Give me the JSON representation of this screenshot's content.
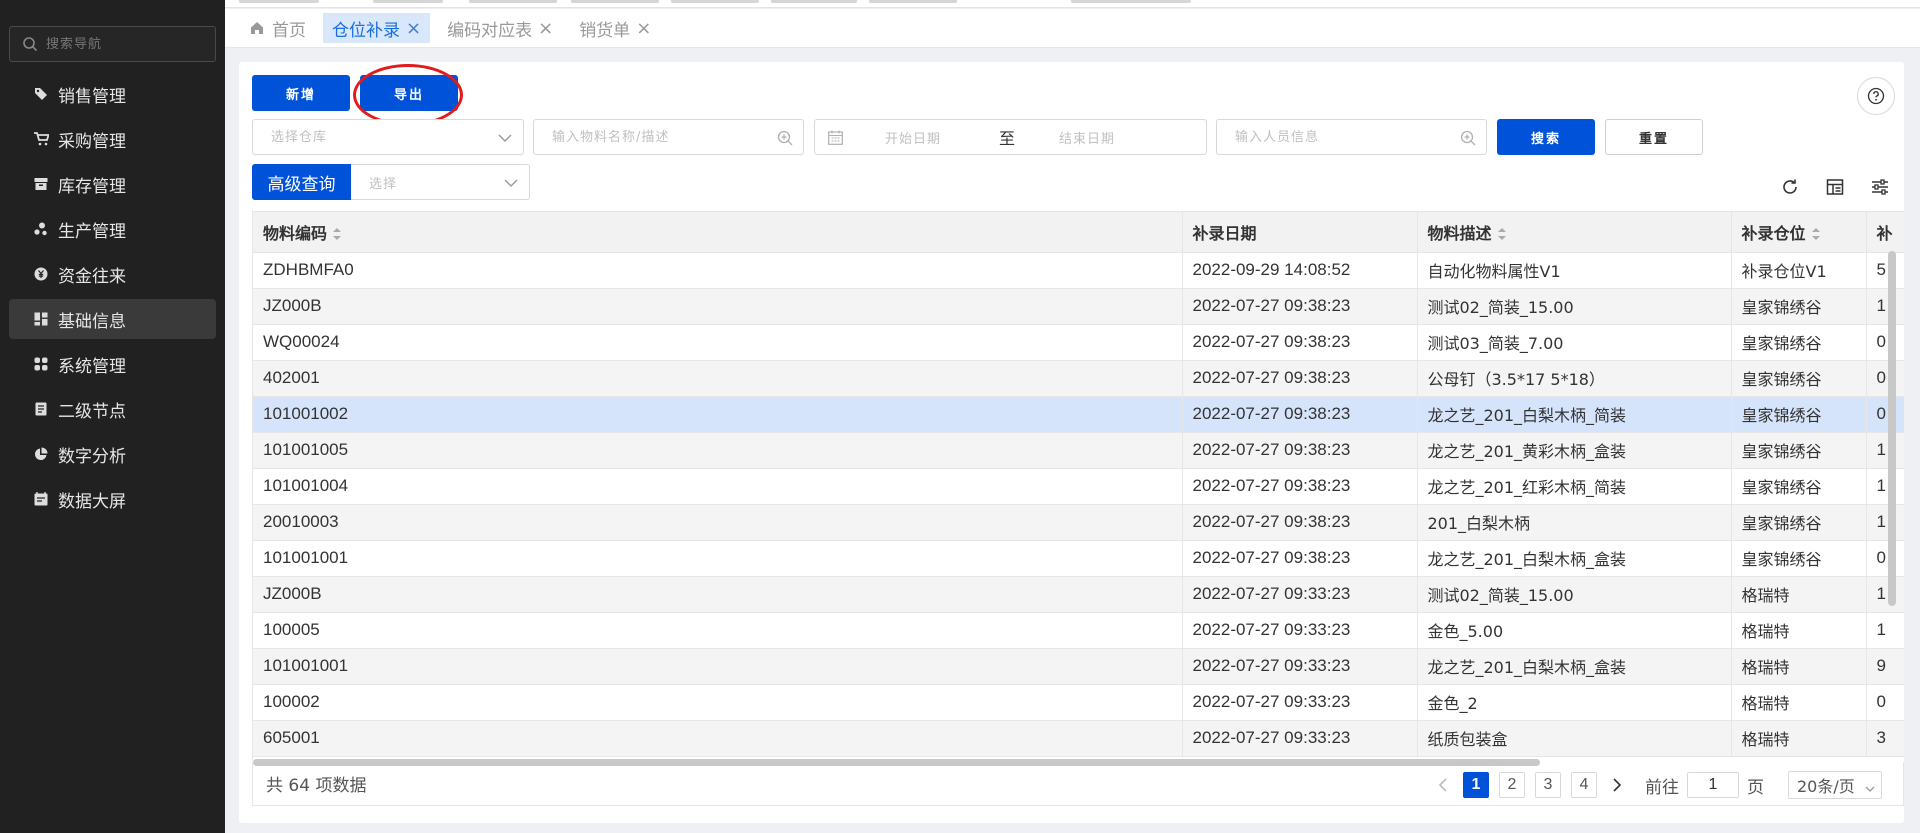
{
  "sidebar": {
    "search_placeholder": "搜索导航",
    "items": [
      {
        "label": "销售管理",
        "icon": "tag-icon"
      },
      {
        "label": "采购管理",
        "icon": "cart-icon"
      },
      {
        "label": "库存管理",
        "icon": "archive-icon"
      },
      {
        "label": "生产管理",
        "icon": "cluster-icon"
      },
      {
        "label": "资金往来",
        "icon": "currency-icon"
      },
      {
        "label": "基础信息",
        "icon": "dashboard-icon",
        "active": true
      },
      {
        "label": "系统管理",
        "icon": "grid-icon"
      },
      {
        "label": "二级节点",
        "icon": "document-icon"
      },
      {
        "label": "数字分析",
        "icon": "pie-chart-icon"
      },
      {
        "label": "数据大屏",
        "icon": "screen-icon"
      }
    ]
  },
  "tabs": [
    {
      "label": "首页",
      "icon": "home-icon",
      "closable": false
    },
    {
      "label": "仓位补录",
      "active": true,
      "closable": true
    },
    {
      "label": "编码对应表",
      "closable": true
    },
    {
      "label": "销货单",
      "closable": true
    }
  ],
  "toolbar": {
    "add_label": "新增",
    "export_label": "导出",
    "warehouse_placeholder": "选择仓库",
    "material_placeholder": "输入物料名称/描述",
    "start_date_placeholder": "开始日期",
    "date_separator": "至",
    "end_date_placeholder": "结束日期",
    "person_placeholder": "输入人员信息",
    "search_label": "搜索",
    "reset_label": "重置",
    "advanced_label": "高级查询",
    "advanced_placeholder": "选择"
  },
  "table": {
    "columns": [
      "物料编码",
      "补录日期",
      "物料描述",
      "补录仓位",
      "补"
    ],
    "rows": [
      [
        "ZDHBMFA0",
        "2022-09-29 14:08:52",
        "自动化物料属性V1",
        "补录仓位V1",
        "5"
      ],
      [
        "JZ000B",
        "2022-07-27 09:38:23",
        "测试02_简装_15.00",
        "皇家锦绣谷",
        "1"
      ],
      [
        "WQ00024",
        "2022-07-27 09:38:23",
        "测试03_简装_7.00",
        "皇家锦绣谷",
        "0"
      ],
      [
        "402001",
        "2022-07-27 09:38:23",
        "公母钉（3.5*17 5*18）",
        "皇家锦绣谷",
        "0"
      ],
      [
        "101001002",
        "2022-07-27 09:38:23",
        "龙之艺_201_白梨木柄_简装",
        "皇家锦绣谷",
        "0"
      ],
      [
        "101001005",
        "2022-07-27 09:38:23",
        "龙之艺_201_黄彩木柄_盒装",
        "皇家锦绣谷",
        "1"
      ],
      [
        "101001004",
        "2022-07-27 09:38:23",
        "龙之艺_201_红彩木柄_简装",
        "皇家锦绣谷",
        "1"
      ],
      [
        "20010003",
        "2022-07-27 09:38:23",
        "201_白梨木柄",
        "皇家锦绣谷",
        "1"
      ],
      [
        "101001001",
        "2022-07-27 09:38:23",
        "龙之艺_201_白梨木柄_盒装",
        "皇家锦绣谷",
        "0"
      ],
      [
        "JZ000B",
        "2022-07-27 09:33:23",
        "测试02_简装_15.00",
        "格瑞特",
        "1"
      ],
      [
        "100005",
        "2022-07-27 09:33:23",
        "金色_5.00",
        "格瑞特",
        "1"
      ],
      [
        "101001001",
        "2022-07-27 09:33:23",
        "龙之艺_201_白梨木柄_盒装",
        "格瑞特",
        "9"
      ],
      [
        "100002",
        "2022-07-27 09:33:23",
        "金色_2",
        "格瑞特",
        "0"
      ],
      [
        "605001",
        "2022-07-27 09:33:23",
        "纸质包装盒",
        "格瑞特",
        "3"
      ]
    ],
    "selected_row": 4
  },
  "footer": {
    "total_text": "共 64 项数据",
    "pages": [
      "1",
      "2",
      "3",
      "4"
    ],
    "current_page": "1",
    "goto_label": "前往",
    "goto_value": "1",
    "page_unit": "页",
    "page_size": "20条/页"
  },
  "colors": {
    "primary": "#0052d9",
    "sidebar_bg": "#212121",
    "selected_row": "#d6e4fb",
    "annotation": "#e21c1c"
  }
}
